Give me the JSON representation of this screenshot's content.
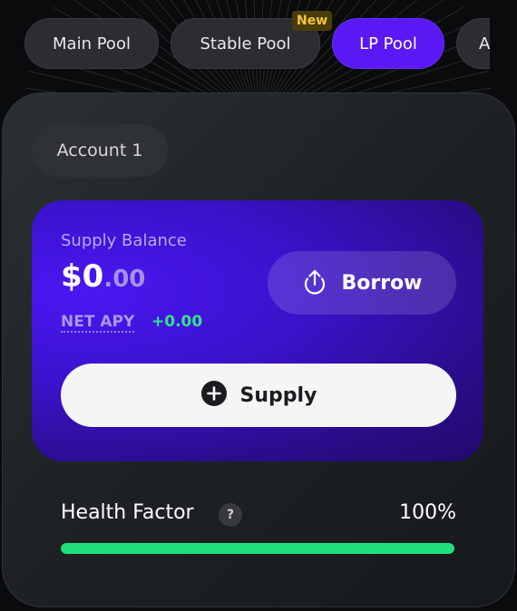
{
  "pools": {
    "tabs": [
      {
        "label": "Main Pool",
        "active": false
      },
      {
        "label": "Stable Pool",
        "active": false
      },
      {
        "label": "LP Pool",
        "active": true
      },
      {
        "label": "A",
        "active": false
      }
    ],
    "new_badge": "New"
  },
  "account": {
    "label": "Account 1"
  },
  "supply_panel": {
    "balance_label": "Supply Balance",
    "amount_main": "$0",
    "amount_cents": ".00",
    "net_apy_label": "NET APY",
    "net_apy_value": "+0.00",
    "borrow_label": "Borrow",
    "supply_label": "Supply"
  },
  "health": {
    "label": "Health Factor",
    "help_glyph": "?",
    "value_text": "100%",
    "level": 1.0
  },
  "colors": {
    "accent": "#5a18f5",
    "health_green": "#21e07c",
    "apy_green": "#34e28a"
  },
  "icons": {
    "borrow": "upload-icon",
    "supply": "plus-circle-icon",
    "help": "help-icon"
  }
}
